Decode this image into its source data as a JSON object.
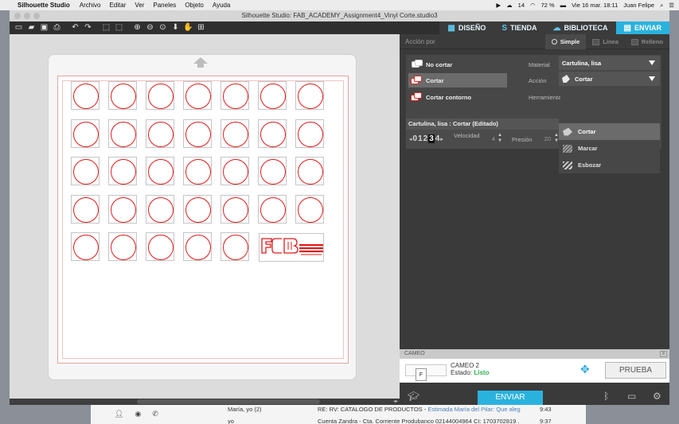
{
  "menubar": {
    "app_name": "Silhouette Studio",
    "items": [
      "Archivo",
      "Editar",
      "Ver",
      "Paneles",
      "Objeto",
      "Ayuda"
    ],
    "status": {
      "cloud_count": "14",
      "battery": "72 %",
      "datetime": "Vie 16 mar.  18:11",
      "user": "Juan Felipe"
    }
  },
  "window": {
    "title": "Silhouette Studio: FAB_ACADEMY_Assignment4_Vinyl Corte.studio3"
  },
  "nav_tabs": [
    {
      "label": "DISEÑO",
      "icon": "grid-icon",
      "active": false
    },
    {
      "label": "TIENDA",
      "icon": "store-icon",
      "active": false
    },
    {
      "label": "BIBLIOTECA",
      "icon": "cloud-icon",
      "active": false
    },
    {
      "label": "ENVIAR",
      "icon": "cutter-icon",
      "active": true
    }
  ],
  "send_panel": {
    "action_by_label": "Acción por",
    "modes": [
      {
        "label": "Simple",
        "active": true
      },
      {
        "label": "Línea",
        "active": false
      },
      {
        "label": "Relleno",
        "active": false
      }
    ],
    "cut_options": [
      {
        "label": "No cortar",
        "selected": false
      },
      {
        "label": "Cortar",
        "selected": true
      },
      {
        "label": "Cortar contorno",
        "selected": false
      }
    ],
    "material_label": "Material",
    "material_value": "Cartulina, lisa",
    "action_label": "Acción",
    "action_value": "Cortar",
    "tool_label": "Herramienta",
    "action_menu": [
      {
        "label": "Cortar",
        "icon": "blade-icon",
        "highlight": true
      },
      {
        "label": "Marcar",
        "icon": "mark-icon",
        "highlight": false
      },
      {
        "label": "Esbozar",
        "icon": "sketch-icon",
        "highlight": false
      }
    ],
    "material_row": "Cartulina, lisa : Cortar (Editado)",
    "blade_digits": [
      "0",
      "1",
      "2",
      "3",
      "4"
    ],
    "speed_label": "Velocidad",
    "speed_value": "4",
    "pressure_label": "Presión",
    "pressure_value": "20"
  },
  "device": {
    "bar_label": "CAMEO",
    "name": "CAMEO 2",
    "state_label": "Estado:",
    "state_value": "Listo",
    "test_button": "PRUEBA",
    "send_button": "ENVIAR"
  },
  "canvas": {
    "rows": 5,
    "cols": 7,
    "logo_text": "FCB"
  },
  "mail": {
    "rows": [
      {
        "from": "María, yo (2)",
        "subject": "RE: RV: CATALOGO DE PRODUCTOS -",
        "preview": "Estimada María del Pilar: Que aleg",
        "time": "9:43"
      },
      {
        "from": "yo",
        "subject": "Cuenta Zandra - Cta. Corriente Produbanco 02144004964 CI: 1703702819 .",
        "preview": "",
        "time": "9:37"
      }
    ]
  },
  "colors": {
    "accent": "#2ab2de",
    "cut_line": "#e01b1b",
    "ready": "#2fb14a"
  }
}
